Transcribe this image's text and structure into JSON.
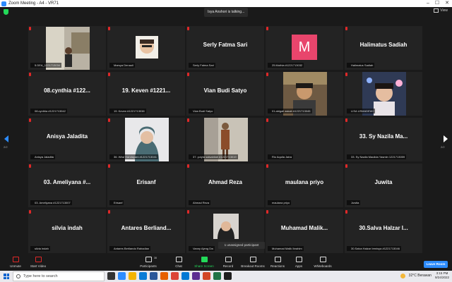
{
  "window": {
    "title": "Zoom Meeting - A4 - VR71",
    "controls": [
      "–",
      "☐",
      "✕"
    ]
  },
  "topbar": {
    "talking": "Isya Anshori is talking...",
    "view_label": "View"
  },
  "pages": {
    "left": "2/2",
    "right": "2/2"
  },
  "tiles": [
    {
      "big": "",
      "label": "5.DEA_1221713034",
      "photo": "photo-woman-room"
    },
    {
      "big": "",
      "label": "Marsya Denaoli",
      "photo": "photo-woman-glasses"
    },
    {
      "big": "Serly Fatma Sari",
      "label": "Serly Fatma Sari"
    },
    {
      "big": "",
      "label": "25.Muthia #1221713032",
      "avatar": "M"
    },
    {
      "big": "Halimatus Sadiah",
      "label": "Halimatus Sadiah"
    },
    {
      "big": "08.cynthia #122...",
      "label": "08.cynthia #1221713042"
    },
    {
      "big": "19. Keven #1221...",
      "label": "19. Keven #1221713038"
    },
    {
      "big": "Vian Budi Satyo",
      "label": "Vian Budi Satyo"
    },
    {
      "big": "",
      "label": "01.abigail askah #1221713045",
      "photo": "photo-man-smile"
    },
    {
      "big": "",
      "label": "LISA USMADEWI",
      "photo": "photo-woman-lights"
    },
    {
      "big": "Anisya Jaladita",
      "label": "Anisya Jaladita"
    },
    {
      "big": "",
      "label": "36. Wiwi Handayani #1221713041",
      "photo": "photo-woman-hijab"
    },
    {
      "big": "",
      "label": "37. yulyta salsabilah #1221713019",
      "photo": "photo-woman-standing"
    },
    {
      "big": "",
      "label": "Rio Aquila Jatra"
    },
    {
      "big": "33. Sy Nazila Ma...",
      "label": "33. Sy Nazila Maulida Yasmin 1221713059"
    },
    {
      "big": "03. Ameliyana #...",
      "label": "03. Ameliyana #1221713007"
    },
    {
      "big": "Erisanf",
      "label": "Erisanf"
    },
    {
      "big": "Ahmad Reza",
      "label": "Ahmad Reza"
    },
    {
      "big": "maulana priyo",
      "label": "maulana priyo"
    },
    {
      "big": "Juwita",
      "label": "Juwita"
    },
    {
      "big": "silvia indah",
      "label": "silvia indah"
    },
    {
      "big": "Antares Berliand...",
      "label": "Antares Berliando Rahadian"
    },
    {
      "big": "",
      "label": "Vanny Ajeng Dw",
      "photo": "photo-woman-hijab-dark"
    },
    {
      "big": "Muhamad Malik...",
      "label": "Muhamad Malik Ibrahim"
    },
    {
      "big": "30.Salva Halzar I...",
      "label": "30.Salva Halzar Irenisya #1221713046"
    }
  ],
  "unassigned": "1 unassigned participant",
  "toolbar": {
    "unmute": "Unmute",
    "start_video": "Start Video",
    "participants": "Participants",
    "participants_count": "38",
    "chat": "Chat",
    "share_screen": "Share Screen",
    "record": "Record",
    "breakout_rooms": "Breakout Rooms",
    "reactions": "Reactions",
    "apps": "Apps",
    "whiteboards": "Whiteboards",
    "leave": "Leave Room"
  },
  "taskbar": {
    "search_placeholder": "Type here to search",
    "weather": "32°C  Berawan",
    "time": "3:15 PM",
    "date": "9/24/2022"
  }
}
